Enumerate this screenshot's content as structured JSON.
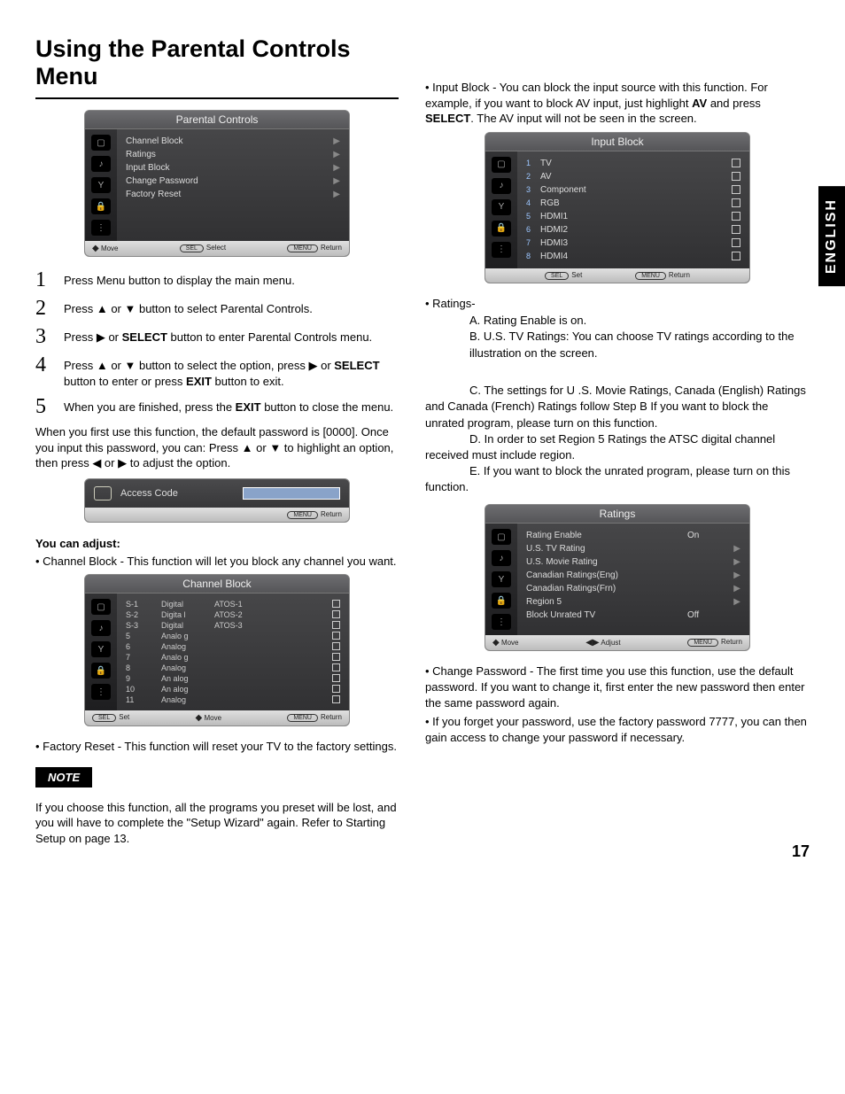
{
  "page": {
    "title": "Using the Parental Controls Menu",
    "language_tab": "ENGLISH",
    "page_number": "17"
  },
  "osd_parental": {
    "title": "Parental Controls",
    "items": [
      "Channel Block",
      "Ratings",
      "Input Block",
      "Change Password",
      "Factory Reset"
    ],
    "footer_left": "Move",
    "footer_mid": "Select",
    "footer_right": "Return",
    "footer_mid_pill": "SEL",
    "footer_right_pill": "MENU"
  },
  "steps": [
    "Press Menu button to display the main menu.",
    "Press ▲ or ▼ button to select Parental Controls.",
    "Press ▶ or SELECT button to enter Parental Controls menu.",
    "Press ▲ or ▼ button to select the option, press ▶ or SELECT button to enter or press EXIT button to exit.",
    "When you are finished, press the EXIT button to close the menu."
  ],
  "after_steps": "When you first use this function, the default password is [0000]. Once you input this password, you can: Press ▲ or ▼ to highlight an option, then press ◀ or ▶ to adjust the option.",
  "osd_access": {
    "label": "Access Code",
    "footer_pill": "MENU",
    "footer_text": "Return"
  },
  "adjust_heading": "You can adjust:",
  "channel_block_text": "Channel Block - This function will let you block any channel you want.",
  "osd_channel_block": {
    "title": "Channel  Block",
    "rows": [
      {
        "c1": "S-1",
        "c2": "Digital",
        "c3": "ATOS-1"
      },
      {
        "c1": "S-2",
        "c2": "Digita l",
        "c3": "ATOS-2"
      },
      {
        "c1": "S-3",
        "c2": "Digital",
        "c3": "ATOS-3"
      },
      {
        "c1": "5",
        "c2": "Analo g",
        "c3": ""
      },
      {
        "c1": "6",
        "c2": "Analog",
        "c3": ""
      },
      {
        "c1": "7",
        "c2": "Analo g",
        "c3": ""
      },
      {
        "c1": "8",
        "c2": "Analog",
        "c3": ""
      },
      {
        "c1": "9",
        "c2": "An alog",
        "c3": ""
      },
      {
        "c1": "10",
        "c2": "An alog",
        "c3": ""
      },
      {
        "c1": "11",
        "c2": "Analog",
        "c3": ""
      }
    ],
    "footer_left": "Set",
    "footer_left_pill": "SEL",
    "footer_mid": "Move",
    "footer_right": "Return",
    "footer_right_pill": "MENU"
  },
  "factory_reset_text": "Factory Reset - This function will reset your TV to the factory settings.",
  "note_label": "NOTE",
  "note_text": "If you choose this function, all the programs you preset will be lost, and you will have to complete the \"Setup Wizard\" again. Refer to Starting Setup on page 13.",
  "input_block_text_a": "Input Block - You can block the input source with this function. For example, if you want to block AV input, just highlight ",
  "input_block_text_b": "AV",
  "input_block_text_c": " and press ",
  "input_block_text_d": "SELECT",
  "input_block_text_e": ". The AV input will not be seen in the screen.",
  "osd_input_block": {
    "title": "Input  Block",
    "rows": [
      {
        "n": "1",
        "lab": "TV"
      },
      {
        "n": "2",
        "lab": "AV"
      },
      {
        "n": "3",
        "lab": "Component"
      },
      {
        "n": "4",
        "lab": "RGB"
      },
      {
        "n": "5",
        "lab": "HDMI1"
      },
      {
        "n": "6",
        "lab": "HDMI2"
      },
      {
        "n": "7",
        "lab": "HDMI3"
      },
      {
        "n": "8",
        "lab": "HDMI4"
      }
    ],
    "footer_left": "Set",
    "footer_left_pill": "SEL",
    "footer_right": "Return",
    "footer_right_pill": "MENU"
  },
  "ratings": {
    "heading": "Ratings-",
    "a": "A.   Rating Enable is on.",
    "b": "B.   U.S. TV Ratings: You can choose TV ratings according to the illustration on the screen.",
    "c": "C.   The settings for U .S. Movie Ratings, Canada (English) Ratings and Canada (French) Ratings follow Step B If you want to block the unrated program, please turn on this function.",
    "d": "D.   In order to set Region 5 Ratings the ATSC digital channel received must include region.",
    "e": "E.   If you want to block the unrated program, please turn on this function."
  },
  "osd_ratings": {
    "title": "Ratings",
    "rows": [
      {
        "lab": "Rating Enable",
        "val": "On",
        "chev": false
      },
      {
        "lab": "U.S. TV Rating",
        "val": "",
        "chev": true
      },
      {
        "lab": "U.S. Movie Rating",
        "val": "",
        "chev": true
      },
      {
        "lab": "Canadian Ratings(Eng)",
        "val": "",
        "chev": true
      },
      {
        "lab": "Canadian Ratings(Frn)",
        "val": "",
        "chev": true
      },
      {
        "lab": "Region 5",
        "val": "",
        "chev": true
      },
      {
        "lab": "Block Unrated TV",
        "val": "Off",
        "chev": false
      }
    ],
    "footer_left": "Move",
    "footer_mid": "Adjust",
    "footer_right": "Return",
    "footer_right_pill": "MENU"
  },
  "change_pw_text": "Change Password - The first time you use this function, use the default password. If you want to change it, first enter the new password then enter the same password again.",
  "forgot_pw_text": "If you forget your password, use the factory password 7777, you can then gain access to change your password if necessary."
}
